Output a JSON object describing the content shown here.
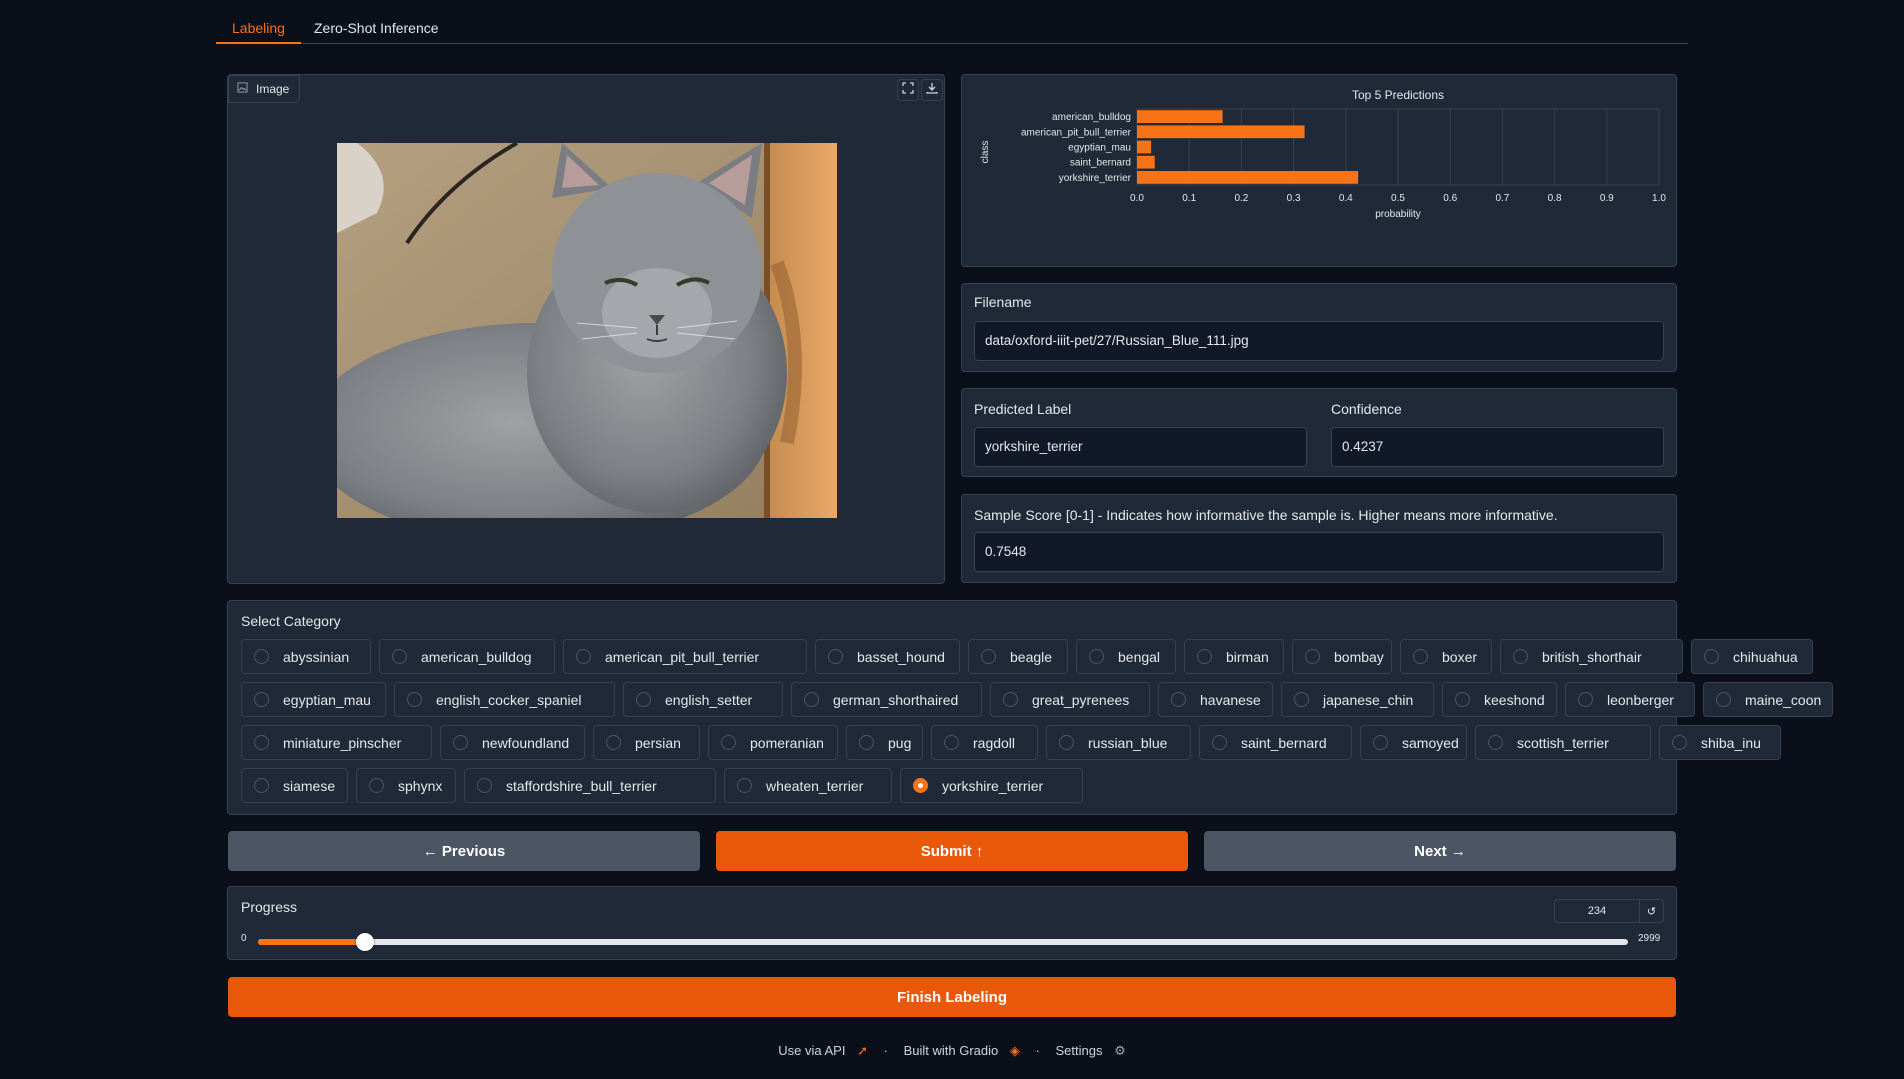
{
  "tabs": [
    {
      "label": "Labeling",
      "active": true
    },
    {
      "label": "Zero-Shot Inference",
      "active": false
    }
  ],
  "image_panel": {
    "label": "Image",
    "icons": [
      "image-icon",
      "fullscreen-icon",
      "download-icon"
    ]
  },
  "chart_data": {
    "type": "bar",
    "orientation": "horizontal",
    "title": "Top 5 Predictions",
    "xlabel": "probability",
    "ylabel": "class",
    "categories": [
      "american_bulldog",
      "american_pit_bull_terrier",
      "egyptian_mau",
      "saint_bernard",
      "yorkshire_terrier"
    ],
    "values": [
      0.164,
      0.321,
      0.027,
      0.034,
      0.4237
    ],
    "xlim": [
      0,
      1.0
    ],
    "xticks": [
      "0.0",
      "0.1",
      "0.2",
      "0.3",
      "0.4",
      "0.5",
      "0.6",
      "0.7",
      "0.8",
      "0.9",
      "1.0"
    ],
    "grid": true,
    "bar_color": "#f97316"
  },
  "filename": {
    "label": "Filename",
    "value": "data/oxford-iiit-pet/27/Russian_Blue_111.jpg"
  },
  "predicted": {
    "label": "Predicted Label",
    "value": "yorkshire_terrier"
  },
  "confidence": {
    "label": "Confidence",
    "value": "0.4237"
  },
  "sample_score": {
    "label": "Sample Score [0-1] - Indicates how informative the sample is. Higher means more informative.",
    "value": "0.7548"
  },
  "category": {
    "label": "Select Category",
    "selected": "yorkshire_terrier",
    "options": [
      "abyssinian",
      "american_bulldog",
      "american_pit_bull_terrier",
      "basset_hound",
      "beagle",
      "bengal",
      "birman",
      "bombay",
      "boxer",
      "british_shorthair",
      "chihuahua",
      "egyptian_mau",
      "english_cocker_spaniel",
      "english_setter",
      "german_shorthaired",
      "great_pyrenees",
      "havanese",
      "japanese_chin",
      "keeshond",
      "leonberger",
      "maine_coon",
      "miniature_pinscher",
      "newfoundland",
      "persian",
      "pomeranian",
      "pug",
      "ragdoll",
      "russian_blue",
      "saint_bernard",
      "samoyed",
      "scottish_terrier",
      "shiba_inu",
      "siamese",
      "sphynx",
      "staffordshire_bull_terrier",
      "wheaten_terrier",
      "yorkshire_terrier"
    ]
  },
  "buttons": {
    "previous": "← Previous",
    "submit": "Submit ↑",
    "next": "Next →",
    "finish": "Finish Labeling"
  },
  "progress": {
    "label": "Progress",
    "value": "234",
    "min": "0",
    "max": "2999",
    "current": 234,
    "total": 2999
  },
  "footer": {
    "api": "Use via API",
    "built": "Built with Gradio",
    "settings": "Settings",
    "sep": "·"
  },
  "colors": {
    "accent": "#f97316",
    "primary_button": "#ea580c",
    "background": "#0b0f19",
    "panel": "#1f2937"
  }
}
